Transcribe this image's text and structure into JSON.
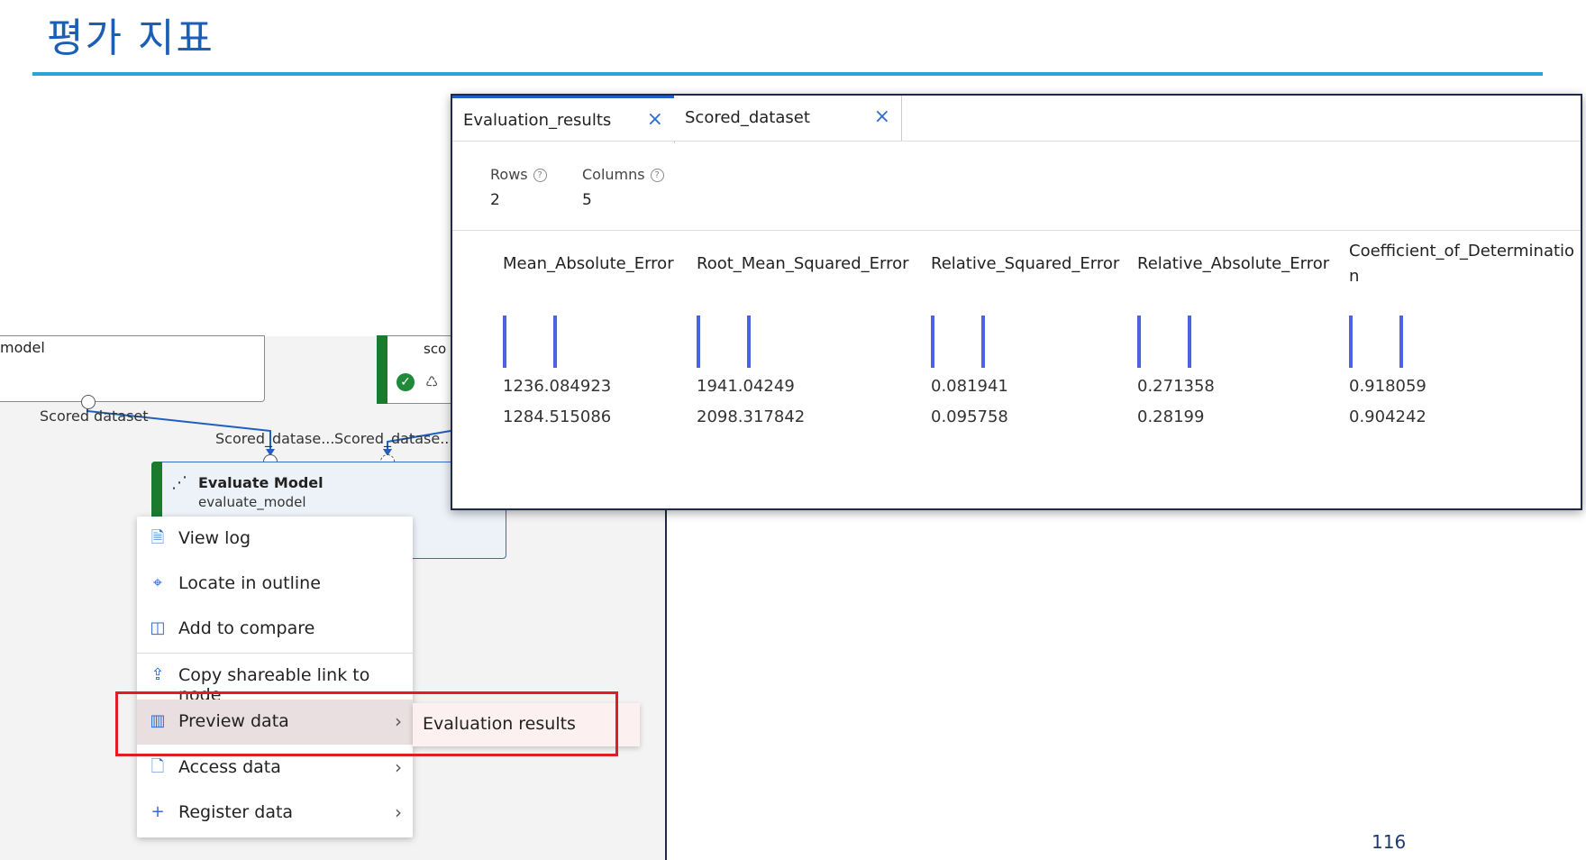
{
  "slide": {
    "title": "평가 지표",
    "page_number": "116"
  },
  "canvas": {
    "model_node_label": "model",
    "score_node_label": "sco",
    "port_labels": [
      "Scored dataset",
      "Scored_datase...",
      "Scored_datase..."
    ],
    "evaluate_node": {
      "title": "Evaluate Model",
      "subtitle": "evaluate_model"
    }
  },
  "context_menu": {
    "items": [
      {
        "label": "View log",
        "icon": "document-icon"
      },
      {
        "label": "Locate in outline",
        "icon": "locate-icon"
      },
      {
        "label": "Add to compare",
        "icon": "compare-icon"
      },
      {
        "label": "Copy shareable link to node",
        "icon": "share-icon"
      },
      {
        "label": "Preview data",
        "icon": "bar-chart-icon"
      },
      {
        "label": "Access data",
        "icon": "data-file-icon"
      },
      {
        "label": "Register data",
        "icon": "plus-icon"
      }
    ],
    "submenu": {
      "label": "Evaluation results"
    }
  },
  "preview_panel": {
    "tabs": [
      {
        "label": "Evaluation_results",
        "active": true
      },
      {
        "label": "Scored_dataset",
        "active": false
      }
    ],
    "rows_label": "Rows",
    "rows_value": "2",
    "columns_label": "Columns",
    "columns_value": "5",
    "columns": [
      {
        "header": "Mean_Absolute_Error",
        "values": [
          "1236.084923",
          "1284.515086"
        ]
      },
      {
        "header": "Root_Mean_Squared_Error",
        "values": [
          "1941.04249",
          "2098.317842"
        ]
      },
      {
        "header": "Relative_Squared_Error",
        "values": [
          "0.081941",
          "0.095758"
        ]
      },
      {
        "header": "Relative_Absolute_Error",
        "values": [
          "0.271358",
          "0.28199"
        ]
      },
      {
        "header": "Coefficient_of_Determinatio",
        "header_wrap": "n",
        "values": [
          "0.918059",
          "0.904242"
        ]
      }
    ]
  },
  "colors": {
    "accent": "#2f6fd1",
    "highlight": "#e31c23",
    "success": "#1f8a3a",
    "rule": "#2ba3d6"
  }
}
